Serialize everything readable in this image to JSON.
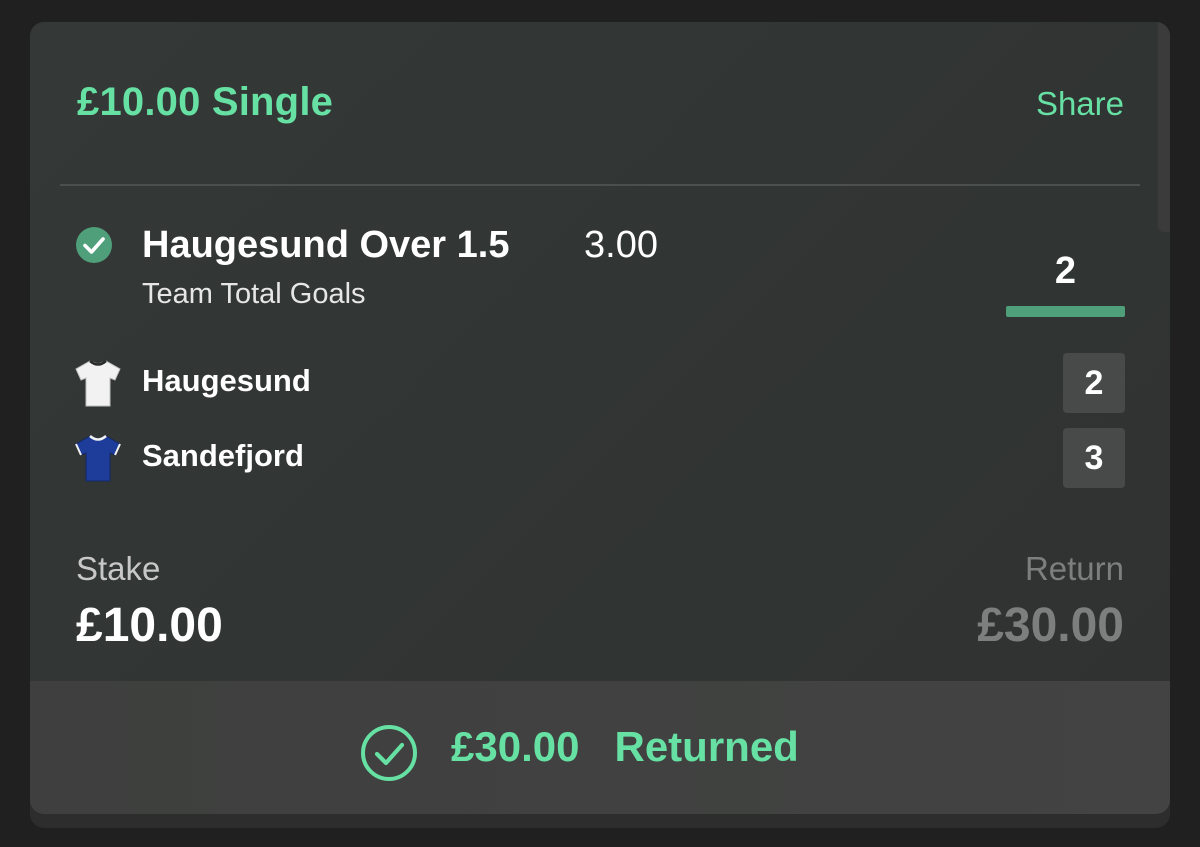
{
  "bet": {
    "title": "£10.00 Single",
    "share_label": "Share"
  },
  "selection": {
    "name": "Haugesund Over 1.5",
    "odds": "3.00",
    "market": "Team Total Goals",
    "progress_value": "2",
    "progress_fraction": 1.0,
    "status_icon": "check-circle-icon"
  },
  "teams": [
    {
      "name": "Haugesund",
      "score": "2",
      "shirt_color": "#f2f2f2",
      "icon": "white-shirt-icon"
    },
    {
      "name": "Sandefjord",
      "score": "3",
      "shirt_color": "#1e3d9a",
      "icon": "blue-shirt-icon"
    }
  ],
  "stake": {
    "label": "Stake",
    "value": "£10.00"
  },
  "return": {
    "label": "Return",
    "value": "£30.00"
  },
  "footer": {
    "amount": "£30.00",
    "status": "Returned",
    "icon": "check-circle-outline-icon"
  },
  "colors": {
    "accent": "#66e0a3",
    "progress": "#4f9f7a",
    "muted": "#7c7f7d"
  }
}
